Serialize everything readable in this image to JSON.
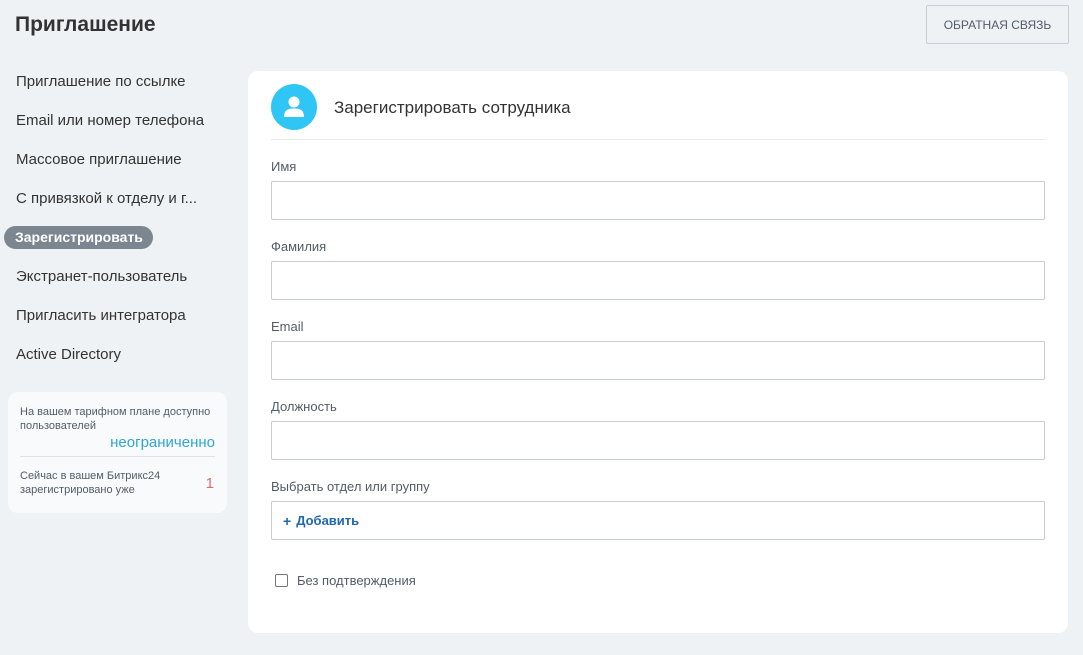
{
  "header": {
    "title": "Приглашение",
    "feedback_label": "Обратная связь"
  },
  "sidebar": {
    "items": [
      {
        "label": "Приглашение по ссылке"
      },
      {
        "label": "Email или номер телефона"
      },
      {
        "label": "Массовое приглашение"
      },
      {
        "label": "С привязкой к отделу и г..."
      },
      {
        "label": "Зарегистрировать",
        "active": true
      },
      {
        "label": "Экстранет-пользователь"
      },
      {
        "label": "Пригласить интегратора"
      },
      {
        "label": "Active Directory"
      }
    ]
  },
  "stats": {
    "plan_label": "На вашем тарифном плане доступно пользователей",
    "plan_value": "неограниченно",
    "registered_label": "Сейчас в вашем Битрикс24 зарегистрировано уже",
    "registered_value": "1"
  },
  "form": {
    "title": "Зарегистрировать сотрудника",
    "fields": {
      "first_name_label": "Имя",
      "first_name_value": "",
      "last_name_label": "Фамилия",
      "last_name_value": "",
      "email_label": "Email",
      "email_value": "",
      "position_label": "Должность",
      "position_value": ""
    },
    "department_label": "Выбрать отдел или группу",
    "add_label": "Добавить",
    "no_confirm_label": "Без подтверждения",
    "no_confirm_checked": false
  },
  "icons": {
    "avatar": "user-icon",
    "add": "plus-icon"
  },
  "colors": {
    "accent": "#2fc6f6",
    "link": "#2067b0",
    "active_pill": "#7b8691",
    "unlimited": "#2fa6d4",
    "count": "#e56a6a"
  }
}
